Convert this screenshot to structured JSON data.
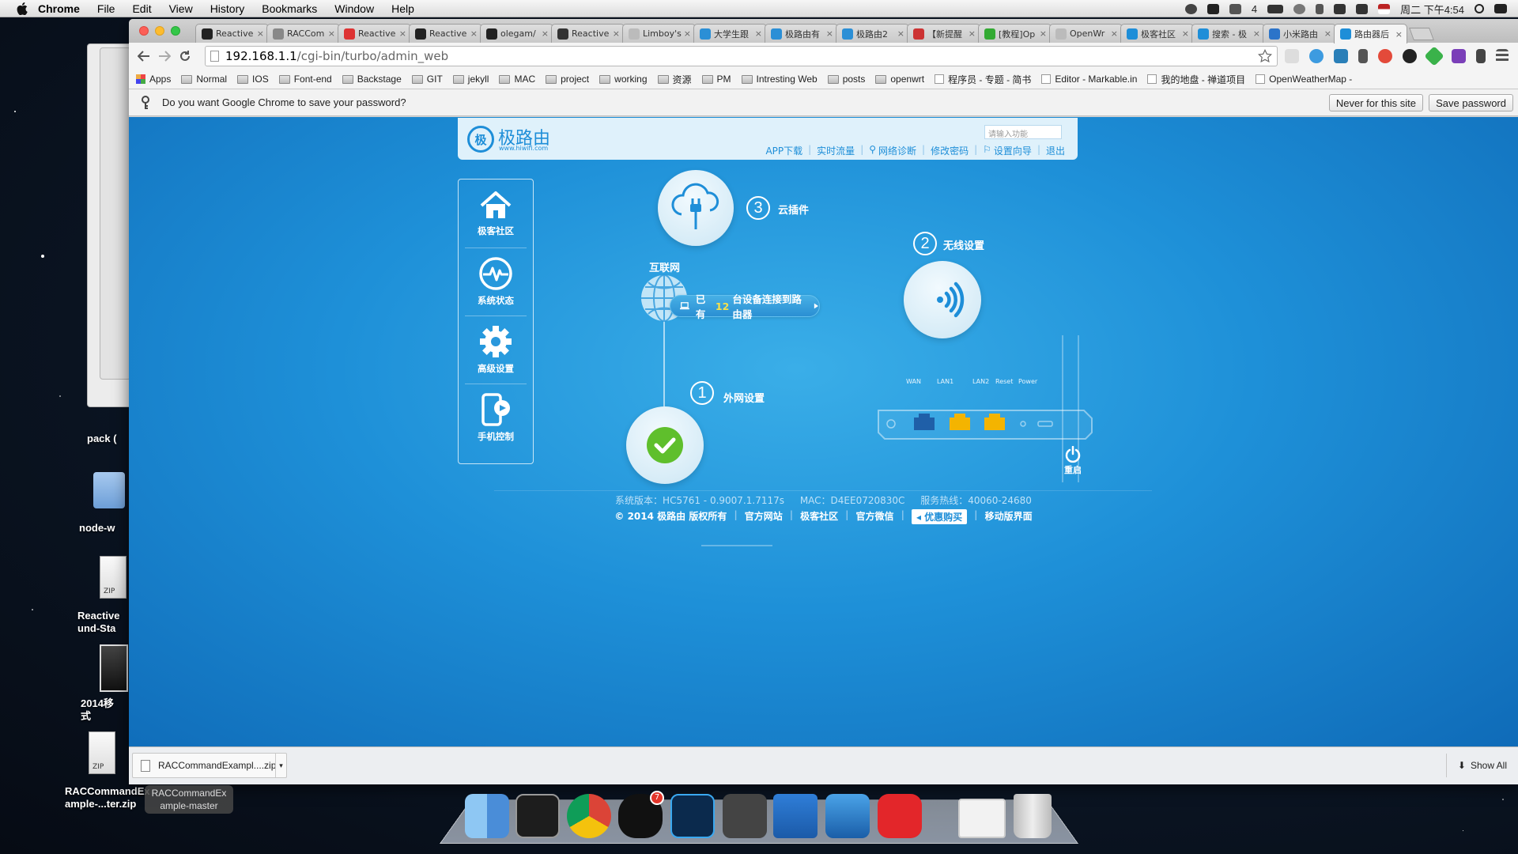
{
  "menubar": {
    "app": "Chrome",
    "items": [
      "File",
      "Edit",
      "View",
      "History",
      "Bookmarks",
      "Window",
      "Help"
    ],
    "battery_count": "4",
    "datetime": "周二 下午4:54"
  },
  "desktop": {
    "labels": [
      "pack (",
      "node-w",
      "Reactive\nund-Sta",
      "2014移\n式",
      "RACCommandEx\nample-...ter.zip"
    ],
    "zip_badge": "ZIP",
    "tooltip": "RACCommandEx\nample-master"
  },
  "browser": {
    "tabs": [
      {
        "title": "Reactive",
        "icon": "github-icon",
        "color": "#222"
      },
      {
        "title": "RACCom",
        "icon": "loading-icon",
        "color": "#888"
      },
      {
        "title": "Reactive",
        "icon": "c-red-icon",
        "color": "#d33"
      },
      {
        "title": "Reactive",
        "icon": "github-icon",
        "color": "#222"
      },
      {
        "title": "olegam/",
        "icon": "github-icon",
        "color": "#222"
      },
      {
        "title": "Reactive",
        "icon": "o-icon",
        "color": "#333"
      },
      {
        "title": "Limboy's",
        "icon": "page-icon",
        "color": "#bbb"
      },
      {
        "title": "大学生跟",
        "icon": "hiwifi-icon",
        "color": "#2b8fd6"
      },
      {
        "title": "极路由有",
        "icon": "hiwifi-icon",
        "color": "#2b8fd6"
      },
      {
        "title": "极路由2",
        "icon": "hiwifi-icon",
        "color": "#2b8fd6"
      },
      {
        "title": "【新提醒",
        "icon": "news-icon",
        "color": "#c33"
      },
      {
        "title": "[教程]Op",
        "icon": "chrome-icon",
        "color": "#3a3"
      },
      {
        "title": "OpenWr",
        "icon": "page-icon",
        "color": "#bbb"
      },
      {
        "title": "极客社区",
        "icon": "hi-icon",
        "color": "#1e8ed8"
      },
      {
        "title": "搜索 - 极",
        "icon": "hi-icon",
        "color": "#1e8ed8"
      },
      {
        "title": "小米路由",
        "icon": "mi-icon",
        "color": "#2c74c9"
      },
      {
        "title": "路由器后",
        "icon": "hi-icon",
        "color": "#1e8ed8",
        "active": true
      }
    ],
    "url_host": "192.168.1.1",
    "url_path": "/cgi-bin/turbo/admin_web",
    "bookmarks": [
      "Apps",
      "Normal",
      "IOS",
      "Font-end",
      "Backstage",
      "GIT",
      "jekyll",
      "MAC",
      "project",
      "working",
      "资源",
      "PM",
      "Intresting Web",
      "posts",
      "openwrt",
      "程序员 - 专题 - 简书",
      "Editor - Markable.in",
      "我的地盘 - 禅道项目",
      "OpenWeatherMap -"
    ],
    "infobar": {
      "message": "Do you want Google Chrome to save your password?",
      "never_label": "Never for this site",
      "save_label": "Save password"
    },
    "download": {
      "filename": "RACCommandExampl....zip",
      "show_all": "Show All"
    }
  },
  "router": {
    "brand": "极路由",
    "brand_url": "www.hiwifi.com",
    "search_placeholder": "请输入功能",
    "links": [
      "APP下载",
      "实时流量",
      "网络诊断",
      "修改密码",
      "设置向导",
      "退出"
    ],
    "sidebar": [
      "极客社区",
      "系统状态",
      "高级设置",
      "手机控制"
    ],
    "internet_label": "互联网",
    "step1": {
      "num": "1",
      "label": "外网设置"
    },
    "step2": {
      "num": "2",
      "label": "无线设置"
    },
    "step3": {
      "num": "3",
      "label": "云插件"
    },
    "devices": {
      "prefix": "已有",
      "count": "12",
      "suffix": "台设备连接到路由器"
    },
    "ports": [
      "WAN",
      "LAN1",
      "LAN2",
      "Reset",
      "Power"
    ],
    "restart_label": "重启",
    "footer_info": [
      "系统版本：HC5761 - 0.9007.1.7117s",
      "MAC：D4EE0720830C",
      "服务热线：40060-24680"
    ],
    "footer_links": [
      "© 2014 极路由 版权所有",
      "官方网站",
      "极客社区",
      "官方微信",
      "优惠购买",
      "移动版界面"
    ]
  },
  "colors": {
    "accent": "#1e8ed8",
    "check_green": "#5fbf2c",
    "port_yellow": "#f4b400",
    "port_blue": "#1f5fa8"
  }
}
